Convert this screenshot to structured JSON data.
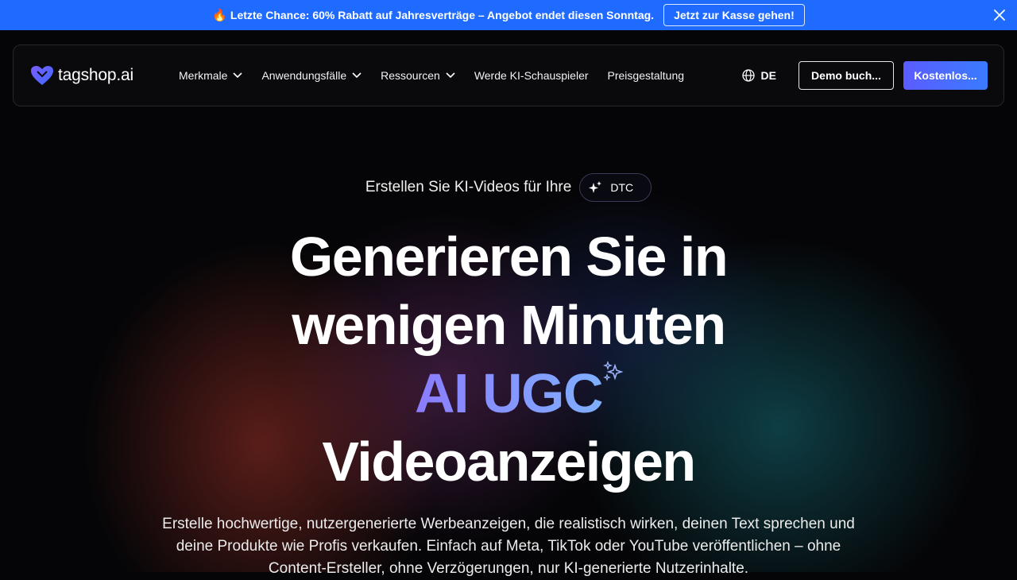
{
  "promo": {
    "icon": "fire-icon",
    "text": "Letzte Chance: 60% Rabatt auf Jahresverträge – Angebot endet diesen Sonntag.",
    "cta": "Jetzt zur Kasse gehen!",
    "bg_color": "#1f6bff"
  },
  "nav": {
    "logo_text": "tagshop.ai",
    "items": [
      {
        "label": "Merkmale",
        "dropdown": true
      },
      {
        "label": "Anwendungsfälle",
        "dropdown": true
      },
      {
        "label": "Ressourcen",
        "dropdown": true
      },
      {
        "label": "Werde KI-Schauspieler",
        "dropdown": false
      },
      {
        "label": "Preisgestaltung",
        "dropdown": false
      }
    ],
    "language": "DE",
    "demo_button": "Demo buch...",
    "free_button": "Kostenlos..."
  },
  "hero": {
    "eyebrow": "Erstellen Sie KI-Videos für Ihre",
    "tag": "DTC",
    "headline_line1": "Generieren Sie in",
    "headline_line2": "wenigen Minuten",
    "headline_accent": "AI UGC",
    "headline_line4": "Videoanzeigen",
    "description": "Erstelle hochwertige, nutzergenerierte Werbeanzeigen, die realistisch wirken, deinen Text sprechen und deine Produkte wie Profis verkaufen. Einfach auf Meta, TikTok oder YouTube veröffentlichen – ohne Content-Ersteller, ohne Verzögerungen, nur KI-generierte Nutzerinhalte.",
    "accent_colors": [
      "#8b7cff",
      "#7fb0ff"
    ]
  }
}
